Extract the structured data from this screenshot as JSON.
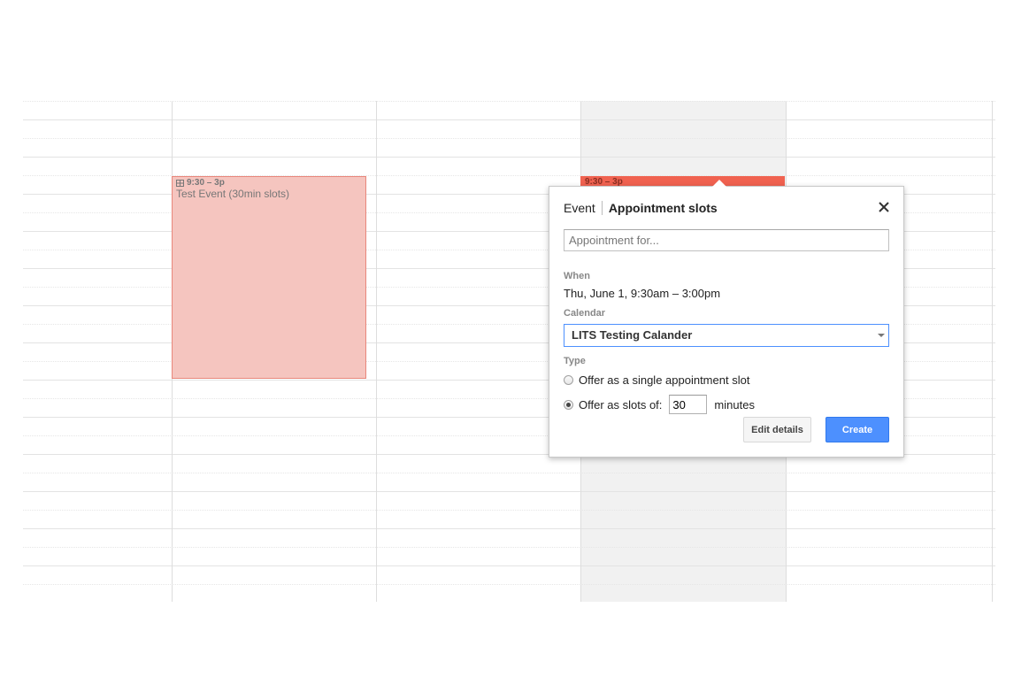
{
  "calendar": {
    "events": [
      {
        "time": "9:30 – 3p",
        "title": "Test Event (30min slots)",
        "icon": "appointment-grid-icon",
        "color": "#f5c5bf"
      },
      {
        "time": "9:30 – 3p",
        "color": "#f06250"
      }
    ],
    "today_column_color": "#f1f1f1"
  },
  "popup": {
    "tabs": {
      "event": "Event",
      "appointment_slots": "Appointment slots"
    },
    "close_icon": "close-icon",
    "title_placeholder": "Appointment for...",
    "when_label": "When",
    "when_value": "Thu, June 1, 9:30am – 3:00pm",
    "calendar_label": "Calendar",
    "calendar_value": "LITS Testing Calander",
    "type_label": "Type",
    "option_single": "Offer as a single appointment slot",
    "option_slots": "Offer as slots of:",
    "slot_length": "30",
    "slot_unit": "minutes",
    "selected_option": "slots",
    "edit_details": "Edit details",
    "create": "Create",
    "accent_color": "#4d90fe"
  }
}
